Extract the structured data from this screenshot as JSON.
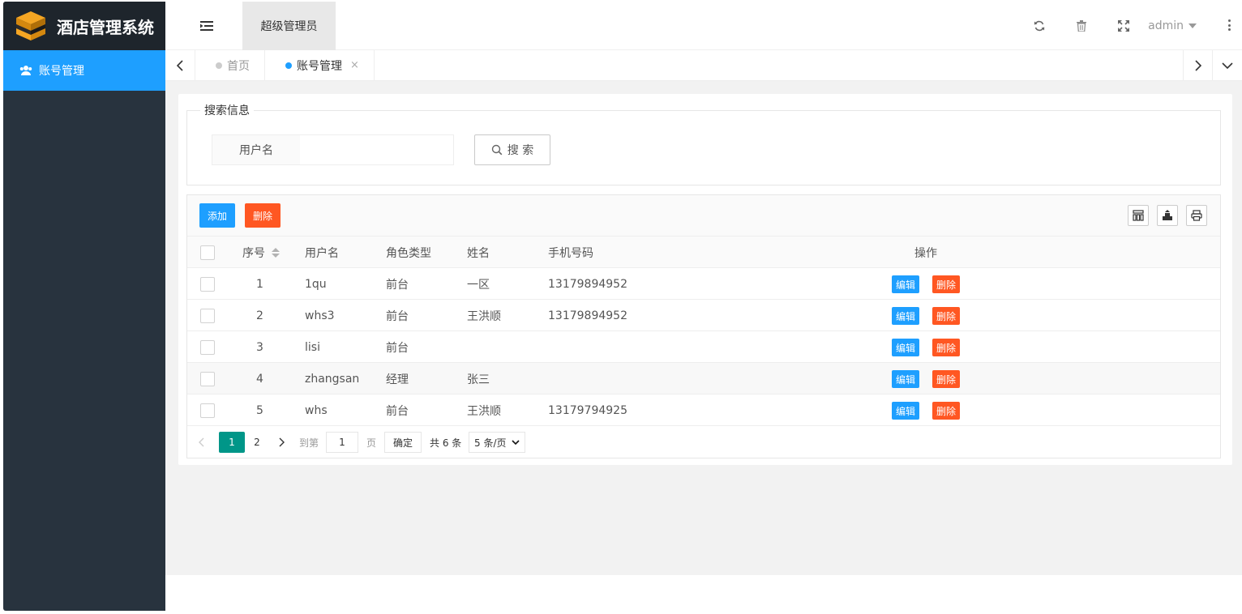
{
  "app": {
    "title": "酒店管理系统"
  },
  "sidebar": {
    "items": [
      {
        "label": "账号管理",
        "icon": "users-icon"
      }
    ]
  },
  "header": {
    "role": "超级管理员",
    "user": "admin"
  },
  "tabs": [
    {
      "label": "首页",
      "active": false
    },
    {
      "label": "账号管理",
      "active": true,
      "close": "×"
    }
  ],
  "search": {
    "legend": "搜索信息",
    "field_label": "用户名",
    "field_value": "",
    "button": "搜 索"
  },
  "toolbar": {
    "add": "添加",
    "delete": "删除"
  },
  "table": {
    "headers": {
      "index": "序号",
      "username": "用户名",
      "role": "角色类型",
      "name": "姓名",
      "phone": "手机号码",
      "actions": "操作"
    },
    "rows": [
      {
        "index": "1",
        "username": "1qu",
        "role": "前台",
        "name": "一区",
        "phone": "13179894952"
      },
      {
        "index": "2",
        "username": "whs3",
        "role": "前台",
        "name": "王洪顺",
        "phone": "13179894952"
      },
      {
        "index": "3",
        "username": "lisi",
        "role": "前台",
        "name": "",
        "phone": ""
      },
      {
        "index": "4",
        "username": "zhangsan",
        "role": "经理",
        "name": "张三",
        "phone": ""
      },
      {
        "index": "5",
        "username": "whs",
        "role": "前台",
        "name": "王洪顺",
        "phone": "13179794925"
      }
    ],
    "row_actions": {
      "edit": "编辑",
      "delete": "删除"
    }
  },
  "pagination": {
    "current": "1",
    "next_page": "2",
    "goto_label": "到第",
    "goto_value": "1",
    "page_unit": "页",
    "confirm": "确定",
    "total": "共 6 条",
    "page_size": "5 条/页"
  },
  "colors": {
    "primary": "#1e9fff",
    "danger": "#ff5722",
    "pager_active": "#009688",
    "sidebar_bg": "#28333e",
    "logo_bg": "#1e252c"
  }
}
